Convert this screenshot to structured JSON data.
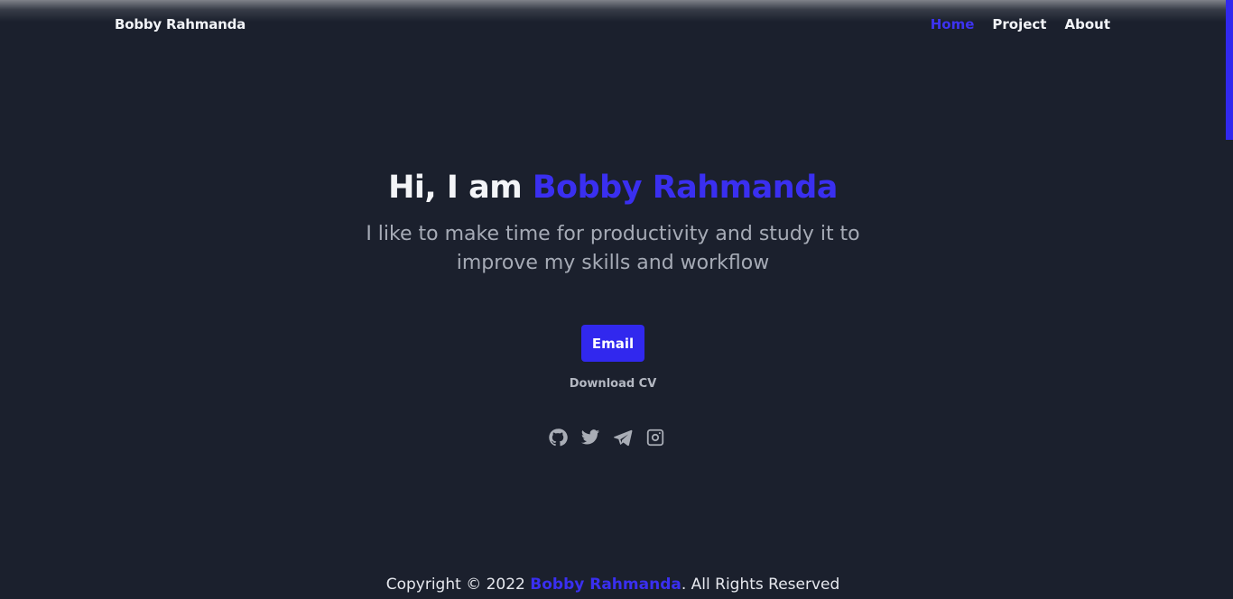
{
  "navbar": {
    "brand": "Bobby Rahmanda",
    "links": [
      {
        "label": "Home",
        "active": true
      },
      {
        "label": "Project",
        "active": false
      },
      {
        "label": "About",
        "active": false
      }
    ]
  },
  "hero": {
    "greeting": "Hi, I am ",
    "name": "Bobby Rahmanda",
    "subtitle": "I like to make time for productivity and study it to improve my skills and workflow",
    "email_button": "Email",
    "download_cv": "Download CV",
    "socials": [
      "github-icon",
      "twitter-icon",
      "telegram-icon",
      "instagram-icon"
    ]
  },
  "footer": {
    "prefix": "Copyright © 2022 ",
    "name": "Bobby Rahmanda",
    "suffix": ". All Rights Reserved"
  },
  "colors": {
    "background": "#1b202d",
    "accent": "#3128ee",
    "text": "#f1f3f7",
    "muted": "#a6abb6"
  }
}
